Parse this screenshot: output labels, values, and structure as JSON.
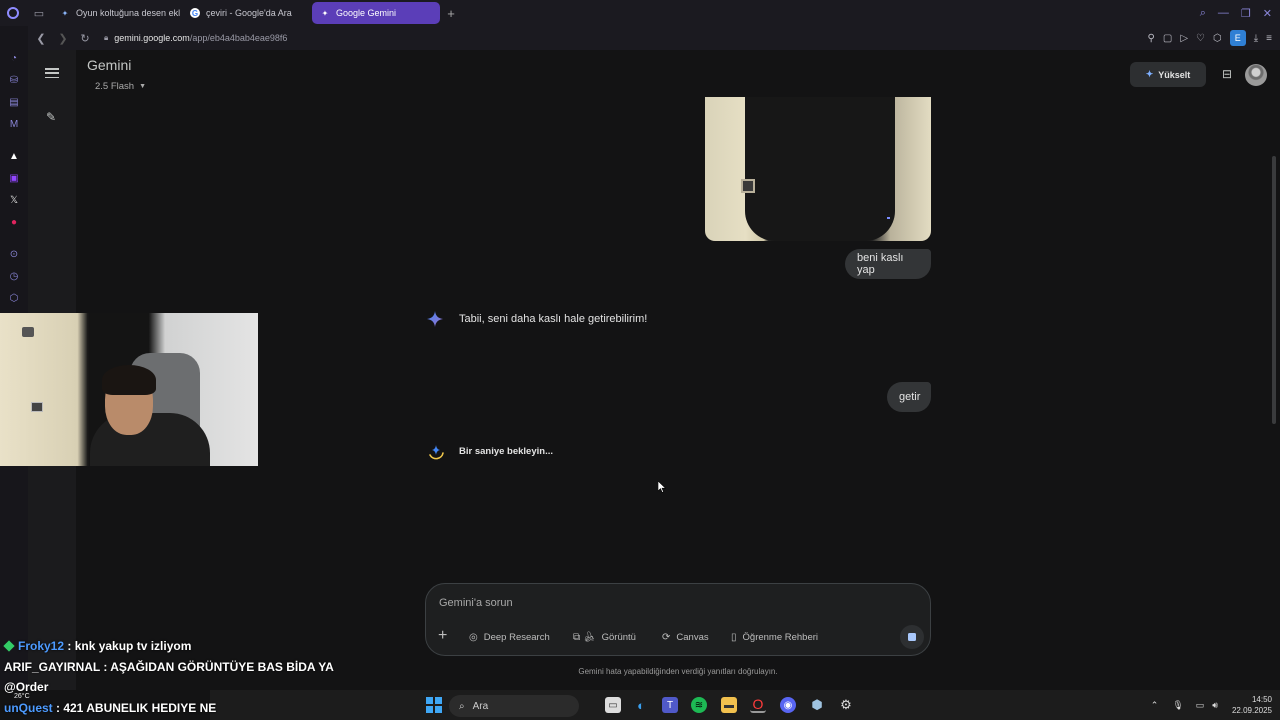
{
  "browser": {
    "tabs": [
      {
        "label": "Oyun koltuğuna desen ekle",
        "icon": "gemini-spark-icon",
        "active": false
      },
      {
        "label": "çeviri - Google'da Ara",
        "icon": "google-icon",
        "active": false
      },
      {
        "label": "Google Gemini",
        "icon": "gemini-spark-icon",
        "active": true
      }
    ],
    "url_host": "gemini.google.com",
    "url_path": "/app/eb4a4bab4eae98f6",
    "extension_label": "E"
  },
  "header": {
    "brand": "Gemini",
    "model": "2.5 Flash",
    "upgrade_label": "Yükselt"
  },
  "conversation": {
    "user_messages": [
      "beni kaslı yap",
      "getir"
    ],
    "assistant_reply": "Tabii, seni daha kaslı hale getirebilirim!",
    "loading_text": "Bir saniye bekleyin..."
  },
  "composer": {
    "placeholder": "Gemini'a sorun",
    "tools": [
      {
        "label": "Deep Research",
        "icon": "deep-research-icon"
      },
      {
        "label": "Görüntü",
        "icon": "image-icon"
      },
      {
        "label": "Canvas",
        "icon": "canvas-icon"
      },
      {
        "label": "Öğrenme Rehberi",
        "icon": "book-icon"
      }
    ],
    "disclaimer": "Gemini hata yapabildiğinden verdiği yanıtları doğrulayın."
  },
  "stream_chat": [
    {
      "user": "Froky12",
      "text": " : knk yakup tv izliyom"
    },
    {
      "user": "ARIF_GAYIRNAL",
      "text": " : AŞAĞIDAN GÖRÜNTÜYE BAS BİDA YA"
    },
    {
      "user": "@Order",
      "text": ""
    },
    {
      "user": "unQuest",
      "text": " : 421 ABUNELIK HEDIYE NE"
    }
  ],
  "taskbar": {
    "search_label": "Ara",
    "time": "14:50",
    "date": "22.09.2025",
    "weather": "26°C"
  },
  "colors": {
    "accent_tab": "#5b3eb8",
    "background": "#131314",
    "user_bubble": "#333537",
    "gemini_blue": "#4285f4"
  }
}
